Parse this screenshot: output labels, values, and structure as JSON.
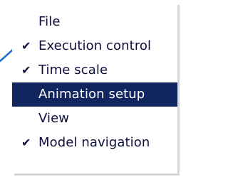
{
  "menu": {
    "items": [
      {
        "label": "File",
        "checked": false,
        "selected": false
      },
      {
        "label": "Execution control",
        "checked": true,
        "selected": false
      },
      {
        "label": "Time scale",
        "checked": true,
        "selected": false
      },
      {
        "label": "Animation setup",
        "checked": false,
        "selected": true
      },
      {
        "label": "View",
        "checked": false,
        "selected": false
      },
      {
        "label": "Model navigation",
        "checked": true,
        "selected": false
      }
    ],
    "check_glyph": "✔"
  },
  "colors": {
    "selection_background": "#11255f",
    "text": "#0c0c3a",
    "pointer_line": "#1f6fd1"
  }
}
